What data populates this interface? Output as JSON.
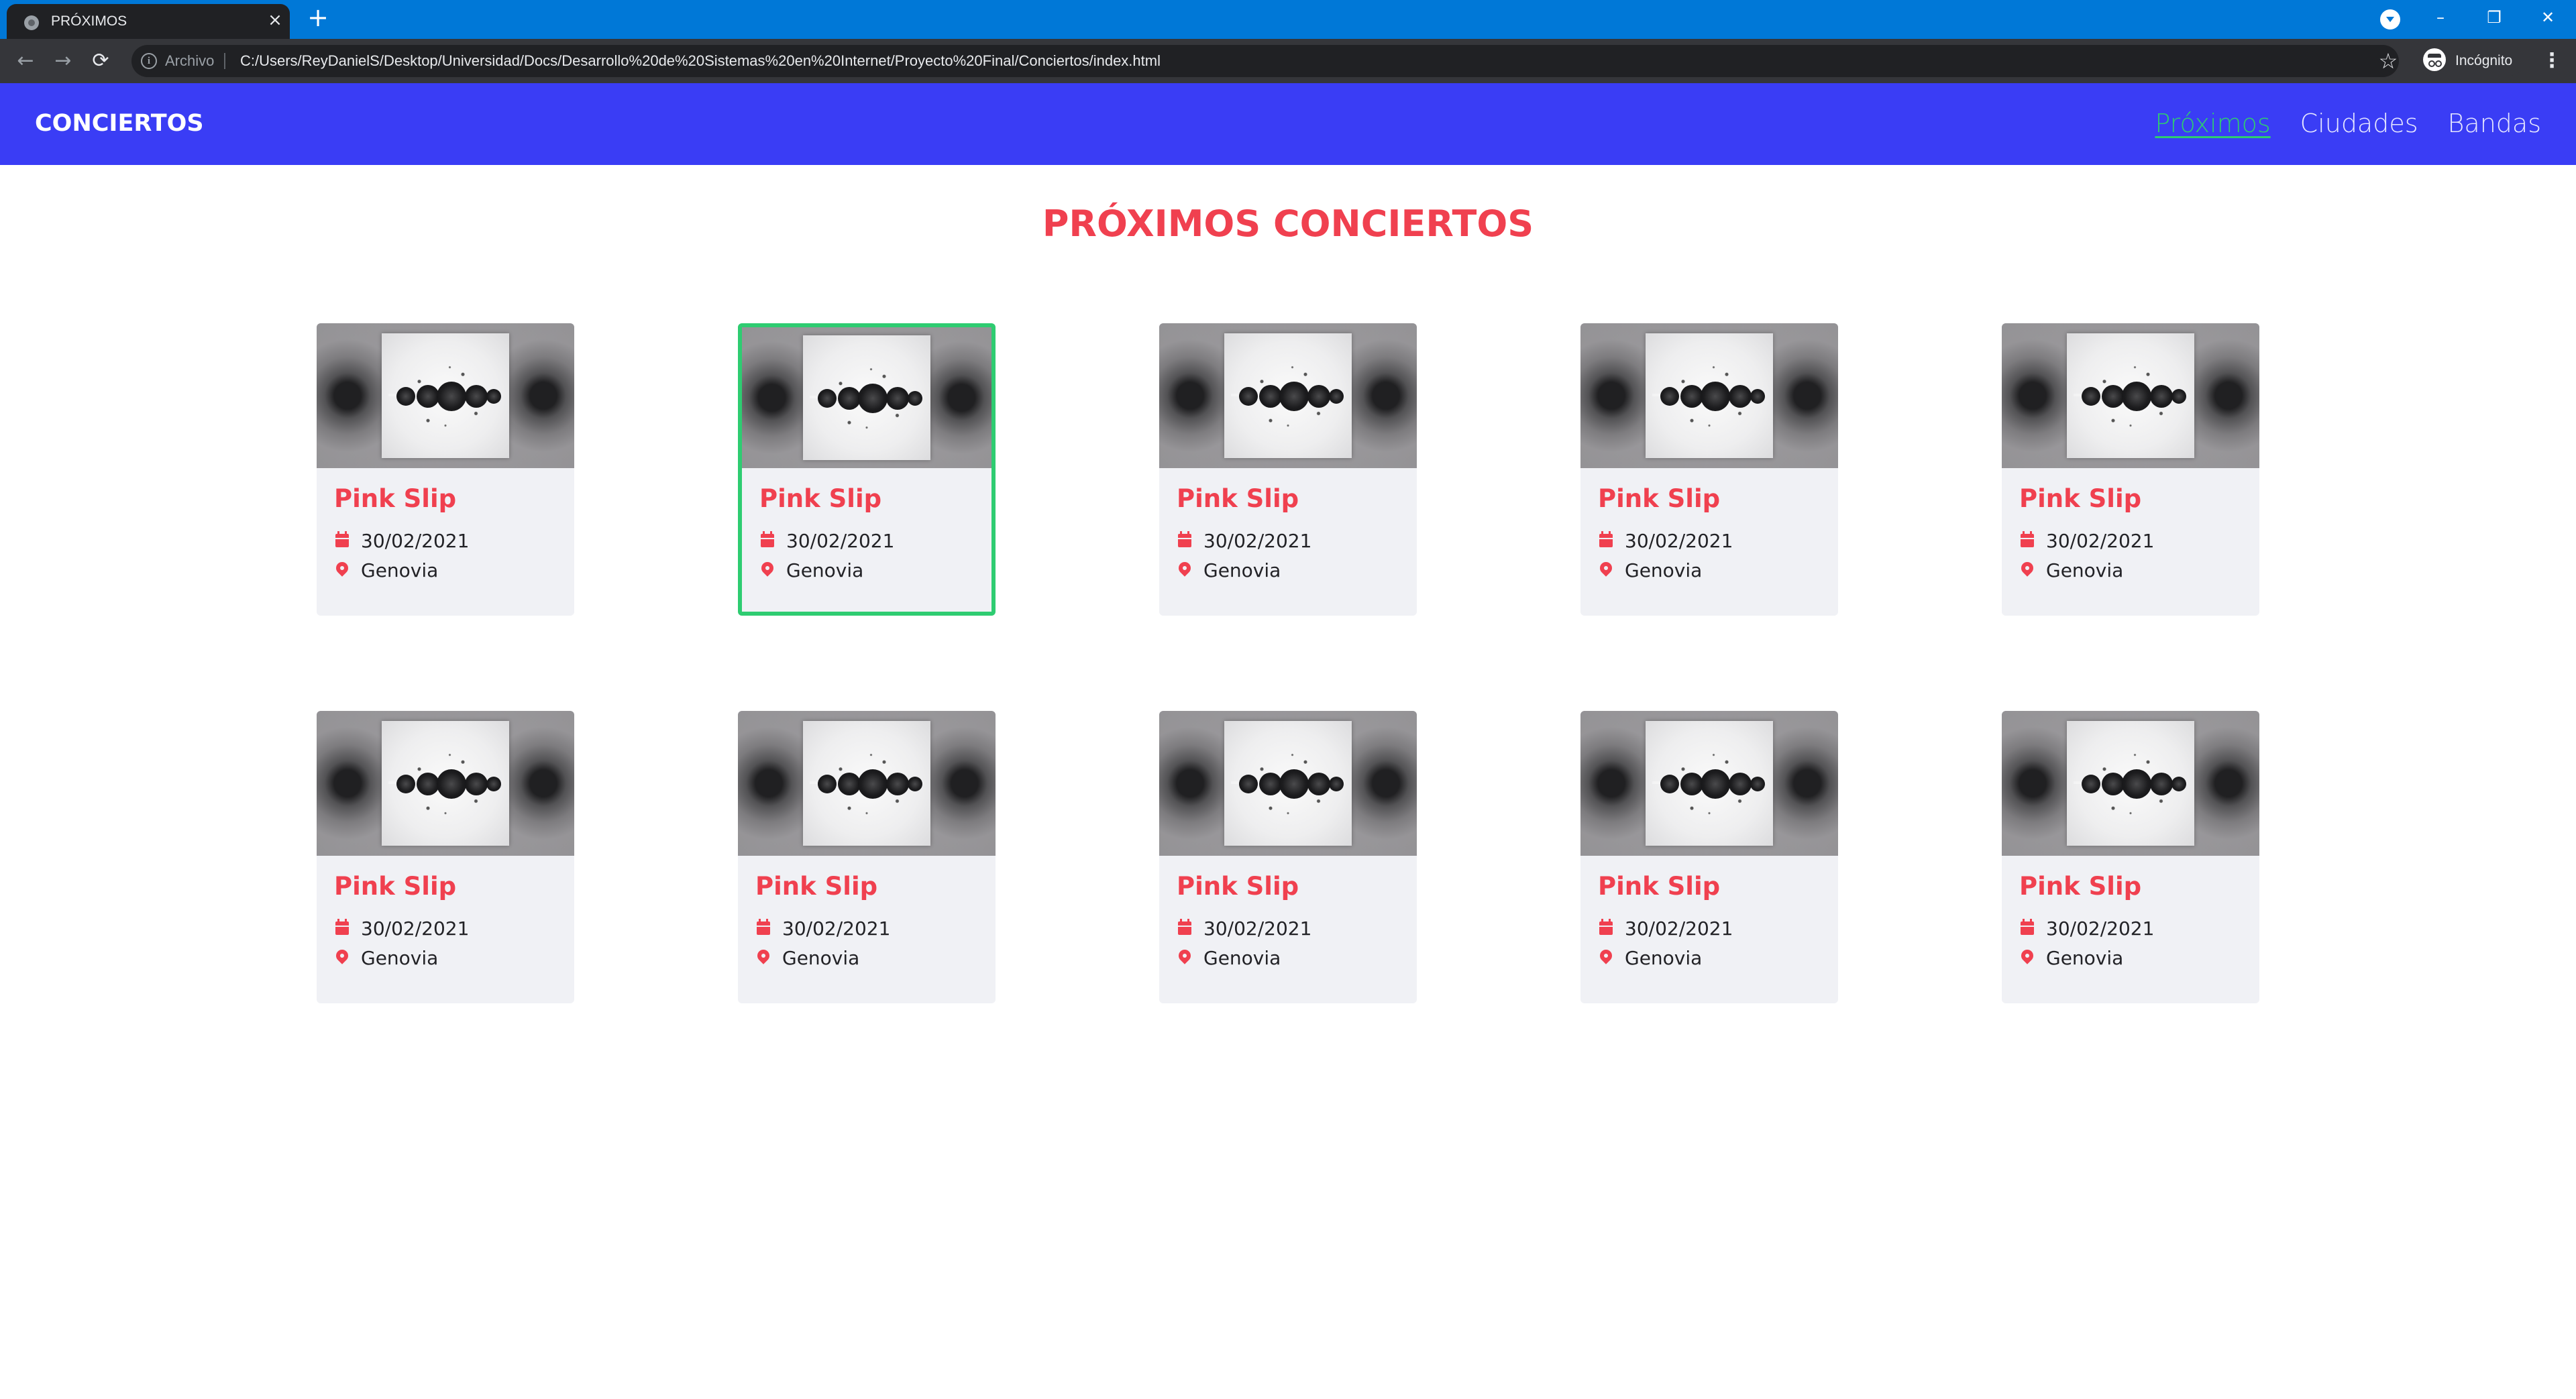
{
  "browser": {
    "tab_title": "PRÓXIMOS",
    "tab_close": "×",
    "new_tab": "+",
    "origin_label": "Archivo",
    "url": "C:/Users/ReyDanielS/Desktop/Universidad/Docs/Desarrollo%20de%20Sistemas%20en%20Internet/Proyecto%20Final/Conciertos/index.html",
    "profile_label": "Incógnito",
    "window_minimize": "–",
    "window_restore": "❐",
    "window_close": "✕",
    "back": "←",
    "forward": "→",
    "reload": "⟳",
    "star": "☆",
    "menu": "⋮"
  },
  "navbar": {
    "brand": "CONCIERTOS",
    "links": [
      {
        "label": "Próximos",
        "active": true
      },
      {
        "label": "Ciudades",
        "active": false
      },
      {
        "label": "Bandas",
        "active": false
      }
    ],
    "active_color": "#2ecc71",
    "background": "#3a3df5"
  },
  "main": {
    "title": "PRÓXIMOS CONCIERTOS",
    "accent_color": "#f0404f",
    "cards": [
      {
        "title": "Pink Slip",
        "date": "30/02/2021",
        "location": "Genovia",
        "focused": false
      },
      {
        "title": "Pink Slip",
        "date": "30/02/2021",
        "location": "Genovia",
        "focused": true
      },
      {
        "title": "Pink Slip",
        "date": "30/02/2021",
        "location": "Genovia",
        "focused": false
      },
      {
        "title": "Pink Slip",
        "date": "30/02/2021",
        "location": "Genovia",
        "focused": false
      },
      {
        "title": "Pink Slip",
        "date": "30/02/2021",
        "location": "Genovia",
        "focused": false
      },
      {
        "title": "Pink Slip",
        "date": "30/02/2021",
        "location": "Genovia",
        "focused": false
      },
      {
        "title": "Pink Slip",
        "date": "30/02/2021",
        "location": "Genovia",
        "focused": false
      },
      {
        "title": "Pink Slip",
        "date": "30/02/2021",
        "location": "Genovia",
        "focused": false
      },
      {
        "title": "Pink Slip",
        "date": "30/02/2021",
        "location": "Genovia",
        "focused": false
      },
      {
        "title": "Pink Slip",
        "date": "30/02/2021",
        "location": "Genovia",
        "focused": false
      }
    ]
  }
}
